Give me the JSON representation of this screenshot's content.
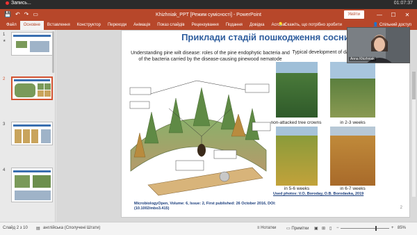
{
  "recording": {
    "label": "Запись...",
    "time": "01:07:37"
  },
  "window": {
    "title": "Khizhniak_PPT [Режим сумісності] - PowerPoint",
    "signin": "Увійти",
    "minimize": "—",
    "maximize": "☐",
    "close": "✕"
  },
  "qat": [
    "💾",
    "↶",
    "↷",
    "▭"
  ],
  "ribbon": {
    "tabs": [
      "Файл",
      "Основне",
      "Вставлення",
      "Конструктор",
      "Переходи",
      "Анімація",
      "Показ слайдів",
      "Рецензування",
      "Подання",
      "Довідка",
      "Acrobat"
    ],
    "active_index": 1,
    "tell_me": "Скажіть, що потрібно зробити",
    "share": "Спільний доступ"
  },
  "thumbnails": [
    {
      "number": "1"
    },
    {
      "number": "2",
      "selected": true
    },
    {
      "number": "3"
    },
    {
      "number": "4"
    }
  ],
  "slide": {
    "title": "Приклади стадій пошкодження сосни",
    "left_caption": "Understanding pine wilt disease: roles of the pine endophytic bacteria and of the bacteria carried by the disease-causing pinewood nematode",
    "right_caption": "Typical development of damage in pine trees",
    "photos": [
      {
        "label": "non-attacked tree crowns"
      },
      {
        "label": "in 2-3 weeks"
      },
      {
        "label": "in 5-6 weeks"
      },
      {
        "label": "in 6-7 weeks"
      }
    ],
    "credit": "Used photos: V.O. Boroday, O.B. Borodavka, 2019",
    "journal": "MicrobiologyOpen, Volume: 6, Issue: 2, First published: 26 October 2016, DOI: (10.1002/mbo3.415)",
    "page_number": "2"
  },
  "webcam": {
    "name": "Anna Khizhniak"
  },
  "status": {
    "slide_of": "Слайд 2 з 10",
    "language": "англійська (Сполучені Штати)",
    "notes": "Нотатки",
    "comments": "Примітки",
    "zoom": "85%"
  },
  "colors": {
    "brand": "#b7472a",
    "title": "#2f5e9e",
    "selected": "#d35230"
  }
}
